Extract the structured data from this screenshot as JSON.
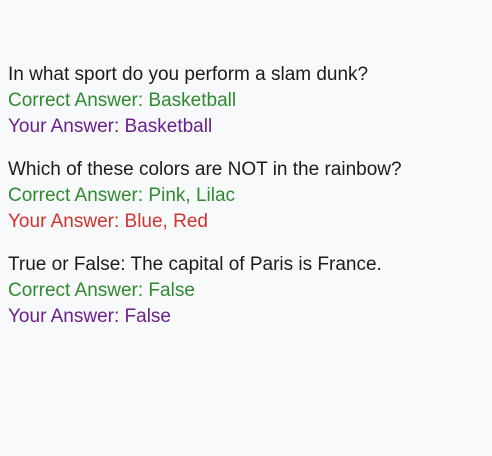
{
  "colors": {
    "background": "#f7f9fb",
    "question": "#1b1b1b",
    "correct_answer": "#2f8a2f",
    "user_answer_correct": "#6b1f8a",
    "user_answer_wrong": "#d2322d"
  },
  "items": [
    {
      "question": "In what sport do you perform a slam dunk?",
      "correct_answer": "Correct Answer: Basketball",
      "user_answer": "Your Answer: Basketball",
      "user_is_correct": true
    },
    {
      "question": "Which of these colors are NOT in the rainbow?",
      "correct_answer": "Correct Answer: Pink, Lilac",
      "user_answer": "Your Answer: Blue, Red",
      "user_is_correct": false
    },
    {
      "question": "True or False: The capital of Paris is France.",
      "correct_answer": "Correct Answer: False",
      "user_answer": "Your Answer: False",
      "user_is_correct": true
    }
  ]
}
